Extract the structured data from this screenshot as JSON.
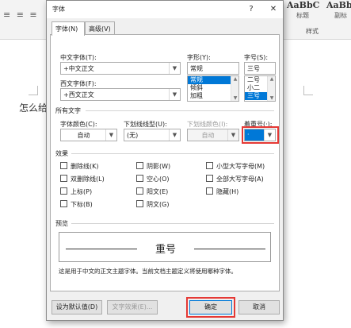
{
  "background": {
    "style_samples": [
      "AaBbC",
      "AaBb"
    ],
    "style_labels": [
      "标题",
      "副标"
    ],
    "ribbon_group_label": "样式",
    "doc_text": "怎么给",
    "align_icons": "≡ ≡ ≡"
  },
  "dialog": {
    "title": "字体",
    "help_label": "?",
    "close_label": "✕",
    "tabs": [
      {
        "label": "字体(N)",
        "active": true
      },
      {
        "label": "高级(V)",
        "active": false
      }
    ],
    "chinese_font": {
      "label": "中文字体(T):",
      "value": "+中文正文"
    },
    "western_font": {
      "label": "西文字体(F):",
      "value": "+西文正文"
    },
    "font_style": {
      "label": "字形(Y):",
      "value": "常规",
      "options": [
        "常规",
        "倾斜",
        "加粗"
      ],
      "selected": "常规"
    },
    "font_size": {
      "label": "字号(S):",
      "value": "三号",
      "options": [
        "二号",
        "小二",
        "三号"
      ],
      "selected": "三号"
    },
    "all_text": {
      "section_label": "所有文字",
      "font_color": {
        "label": "字体颜色(C):",
        "value": "自动"
      },
      "underline_style": {
        "label": "下划线线型(U):",
        "value": "(无)"
      },
      "underline_color": {
        "label": "下划线颜色(I):",
        "value": "自动"
      },
      "emphasis_mark": {
        "label": "着重号(·):",
        "value": "·"
      }
    },
    "effects": {
      "section_label": "效果",
      "items": [
        {
          "label": "删除线(K)",
          "checked": false
        },
        {
          "label": "双删除线(L)",
          "checked": false
        },
        {
          "label": "上标(P)",
          "checked": false
        },
        {
          "label": "下标(B)",
          "checked": false
        },
        {
          "label": "阴影(W)",
          "checked": false
        },
        {
          "label": "空心(O)",
          "checked": false
        },
        {
          "label": "阳文(E)",
          "checked": false
        },
        {
          "label": "阴文(G)",
          "checked": false
        },
        {
          "label": "小型大写字母(M)",
          "checked": false
        },
        {
          "label": "全部大写字母(A)",
          "checked": false
        },
        {
          "label": "隐藏(H)",
          "checked": false
        }
      ]
    },
    "preview": {
      "section_label": "预览",
      "sample_text": "重号",
      "description": "这是用于中文的正文主题字体。当前文档主题定义将使用哪种字体。"
    },
    "buttons": {
      "set_default": "设为默认值(D)",
      "text_effects": "文字效果(E)...",
      "ok": "确定",
      "cancel": "取消"
    },
    "highlight_color": "#e53935",
    "accent_color": "#0078d7"
  }
}
